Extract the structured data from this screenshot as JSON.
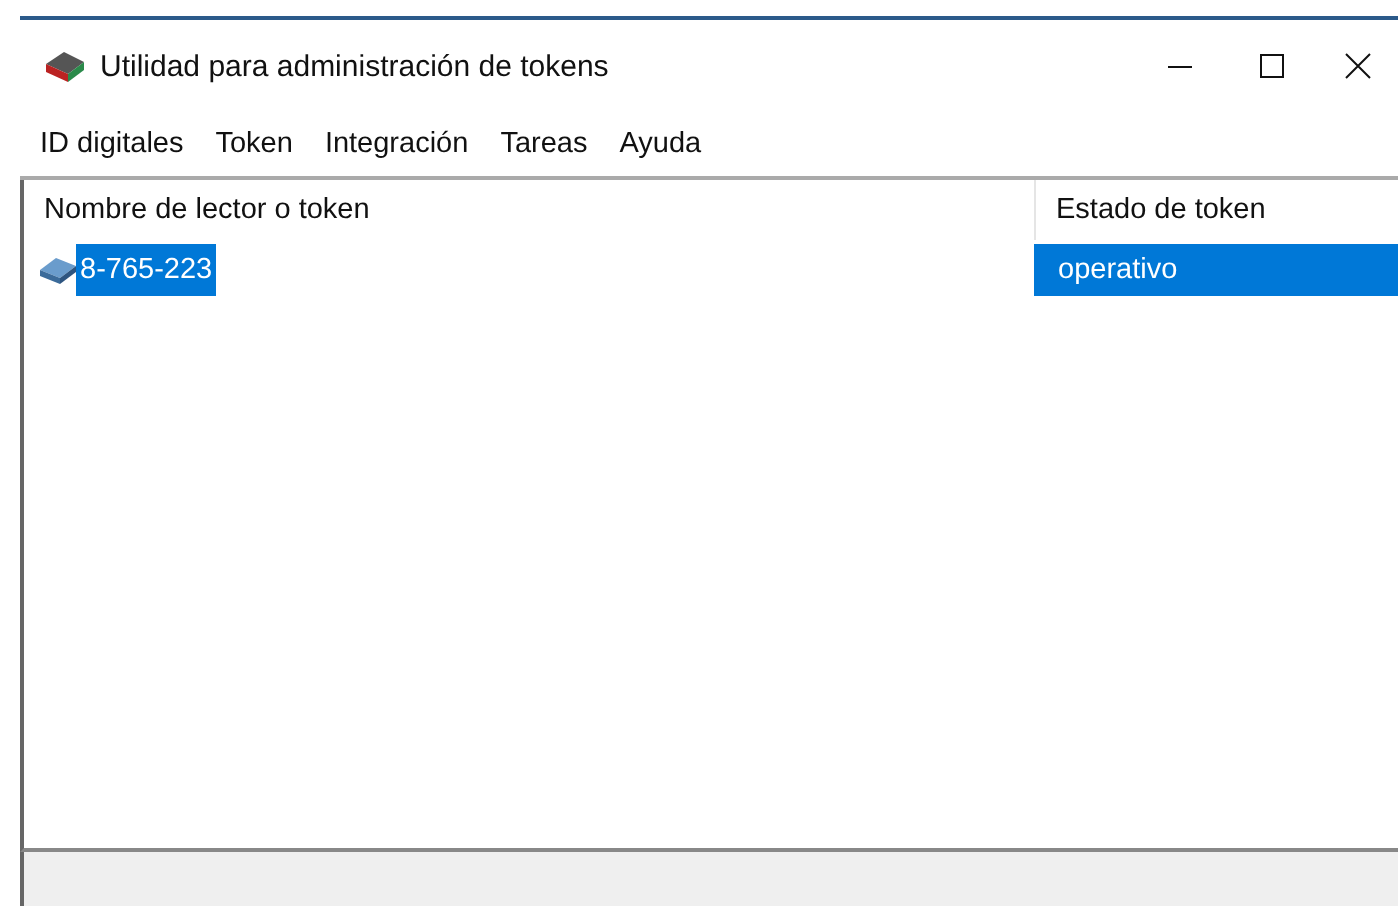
{
  "window": {
    "title": "Utilidad para administración de tokens"
  },
  "menu": [
    "ID digitales",
    "Token",
    "Integración",
    "Tareas",
    "Ayuda"
  ],
  "table": {
    "columns": [
      "Nombre de lector o token",
      "Estado de token"
    ],
    "rows": [
      {
        "name": "8-765-223",
        "status": "operativo",
        "selected": true
      }
    ]
  }
}
